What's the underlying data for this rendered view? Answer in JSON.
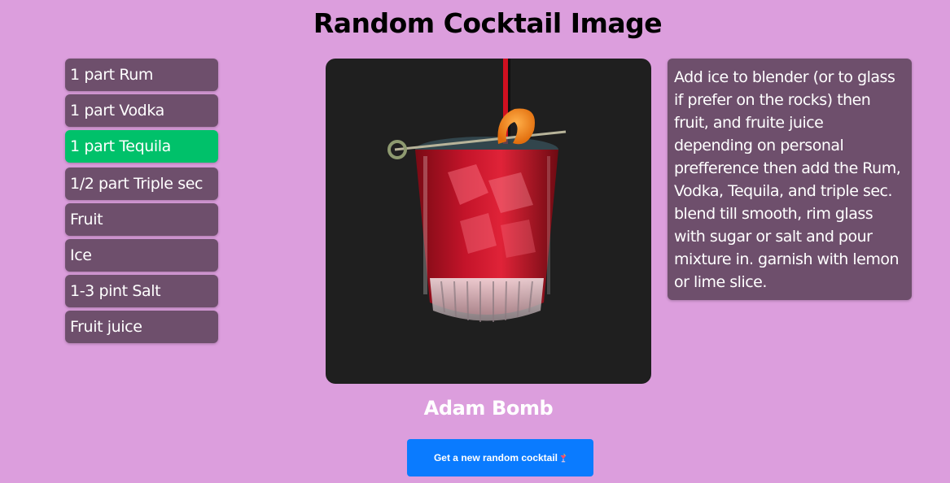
{
  "page": {
    "title": "Random Cocktail Image"
  },
  "ingredients": [
    "1 part Rum",
    "1 part Vodka",
    "1 part Tequila",
    "1/2 part Triple sec",
    "Fruit",
    "Ice",
    "1-3 pint Salt",
    "Fruit juice"
  ],
  "highlighted_ingredient_index": 2,
  "cocktail": {
    "name": "Adam Bomb",
    "instructions": "Add ice to blender (or to glass if prefer on the rocks) then fruit, and fruite juice depending on personal prefference then add the Rum, Vodka, Tequila, and triple sec. blend till smooth, rim glass with sugar or salt and pour mixture in. garnish with lemon or lime slice."
  },
  "button": {
    "label": "Get a new random cocktail",
    "icon": "tropical-drink-icon"
  },
  "colors": {
    "background": "#dc9edd",
    "card": "#6e4f6c",
    "highlight": "#00c16a",
    "button": "#0a7bff"
  }
}
